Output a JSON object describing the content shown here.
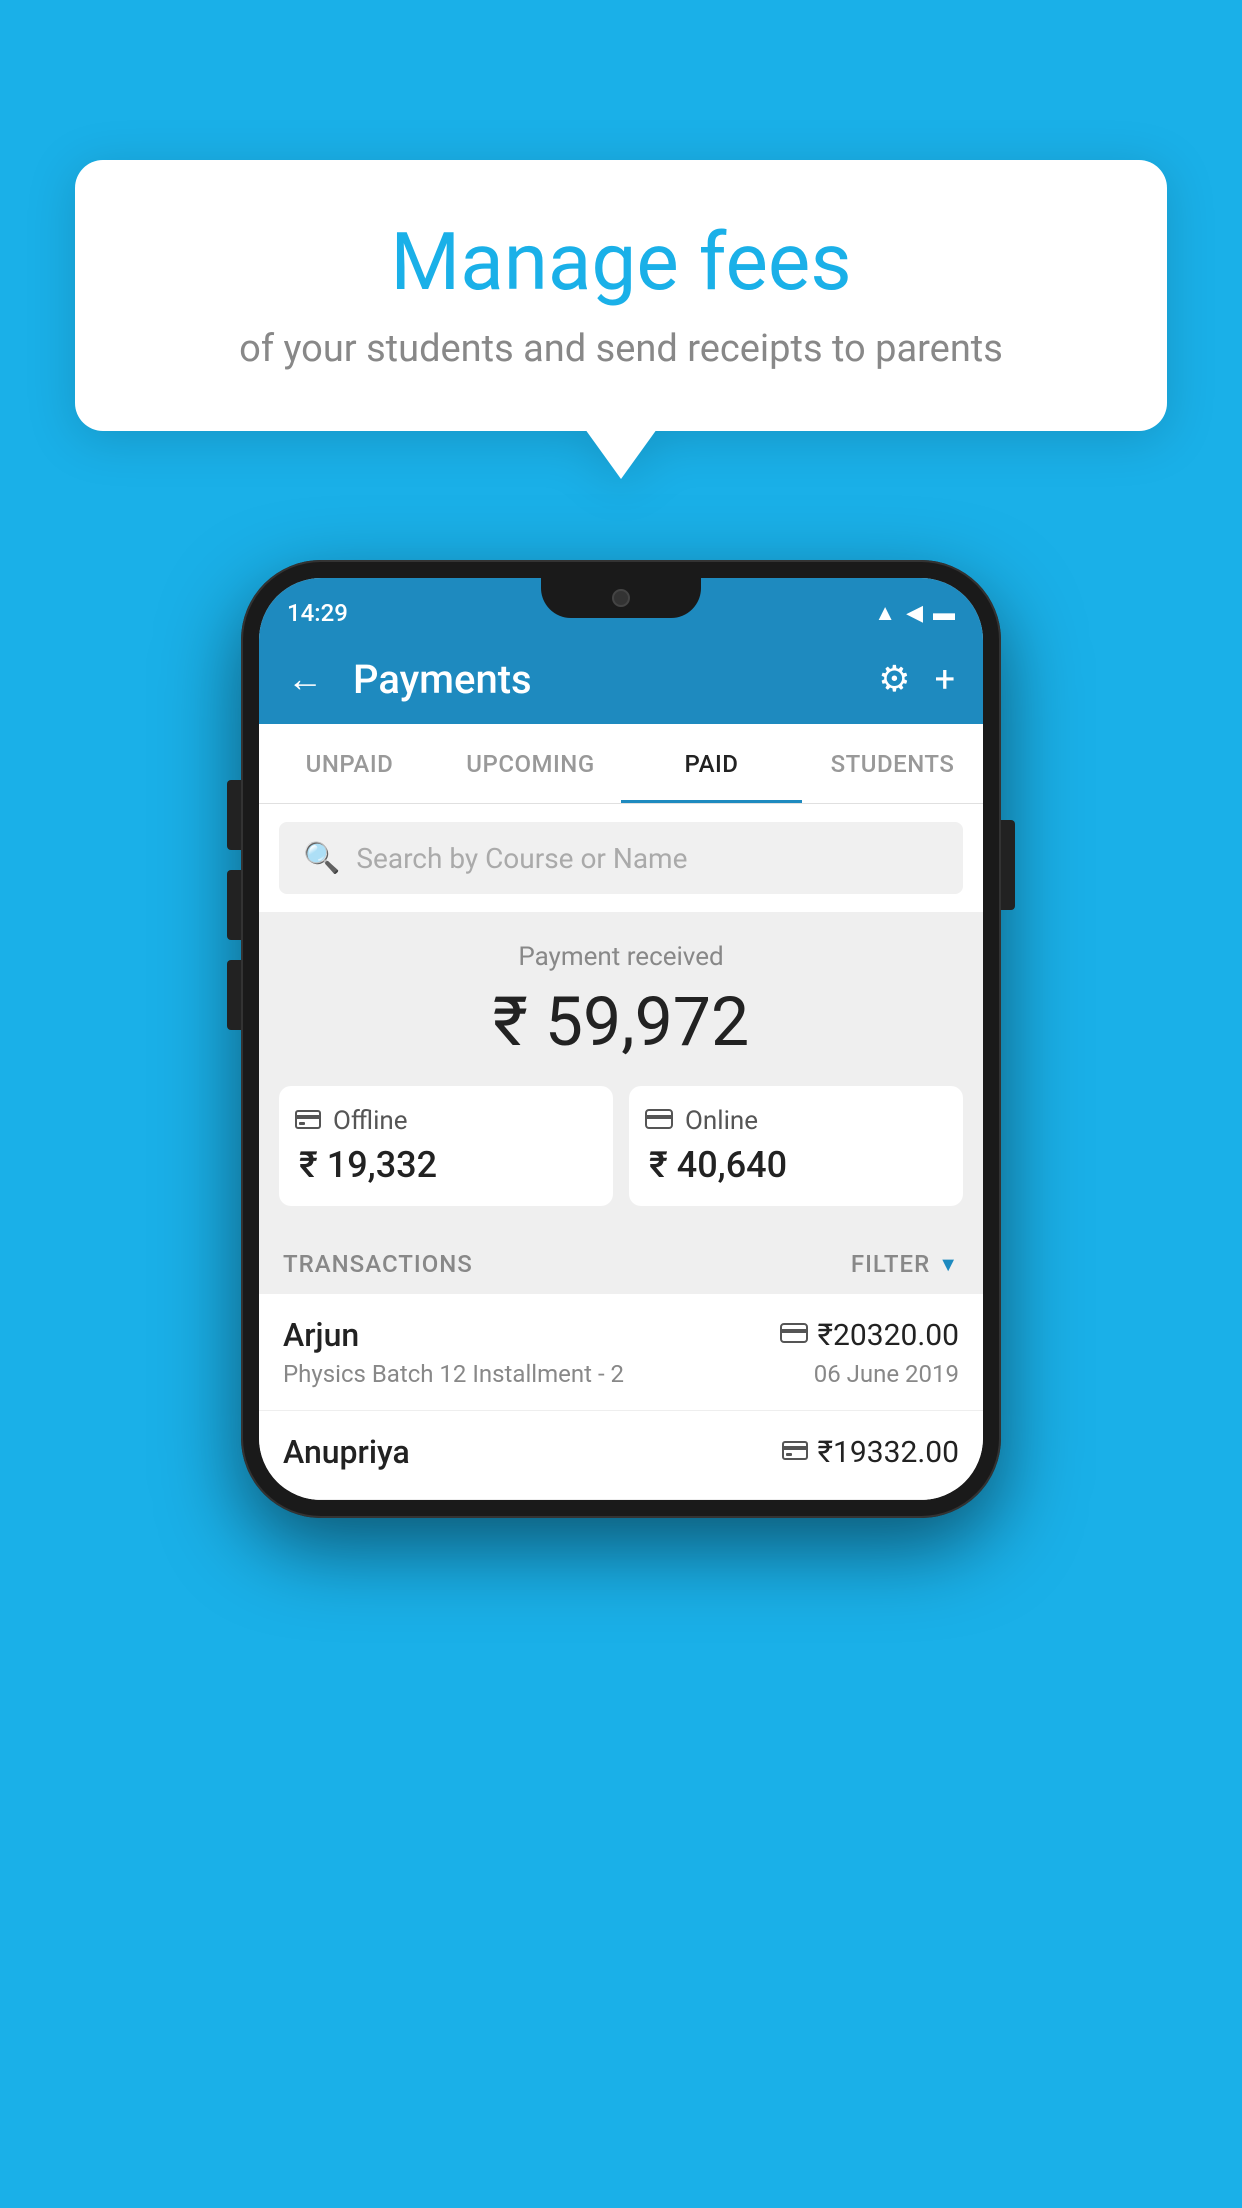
{
  "background_color": "#1ab0e8",
  "bubble": {
    "title": "Manage fees",
    "subtitle": "of your students and send receipts to parents"
  },
  "status_bar": {
    "time": "14:29",
    "wifi": "▲",
    "signal": "▲",
    "battery": "▪"
  },
  "header": {
    "title": "Payments",
    "back_label": "←",
    "settings_label": "⚙",
    "add_label": "+"
  },
  "tabs": [
    {
      "label": "UNPAID",
      "active": false
    },
    {
      "label": "UPCOMING",
      "active": false
    },
    {
      "label": "PAID",
      "active": true
    },
    {
      "label": "STUDENTS",
      "active": false
    }
  ],
  "search": {
    "placeholder": "Search by Course or Name"
  },
  "payment": {
    "label": "Payment received",
    "amount": "₹ 59,972",
    "offline_label": "Offline",
    "offline_amount": "₹ 19,332",
    "online_label": "Online",
    "online_amount": "₹ 40,640"
  },
  "transactions": {
    "label": "TRANSACTIONS",
    "filter_label": "FILTER"
  },
  "transaction_list": [
    {
      "name": "Arjun",
      "course": "Physics Batch 12 Installment - 2",
      "amount": "₹20320.00",
      "date": "06 June 2019",
      "type": "online"
    },
    {
      "name": "Anupriya",
      "course": "",
      "amount": "₹19332.00",
      "date": "",
      "type": "offline"
    }
  ]
}
